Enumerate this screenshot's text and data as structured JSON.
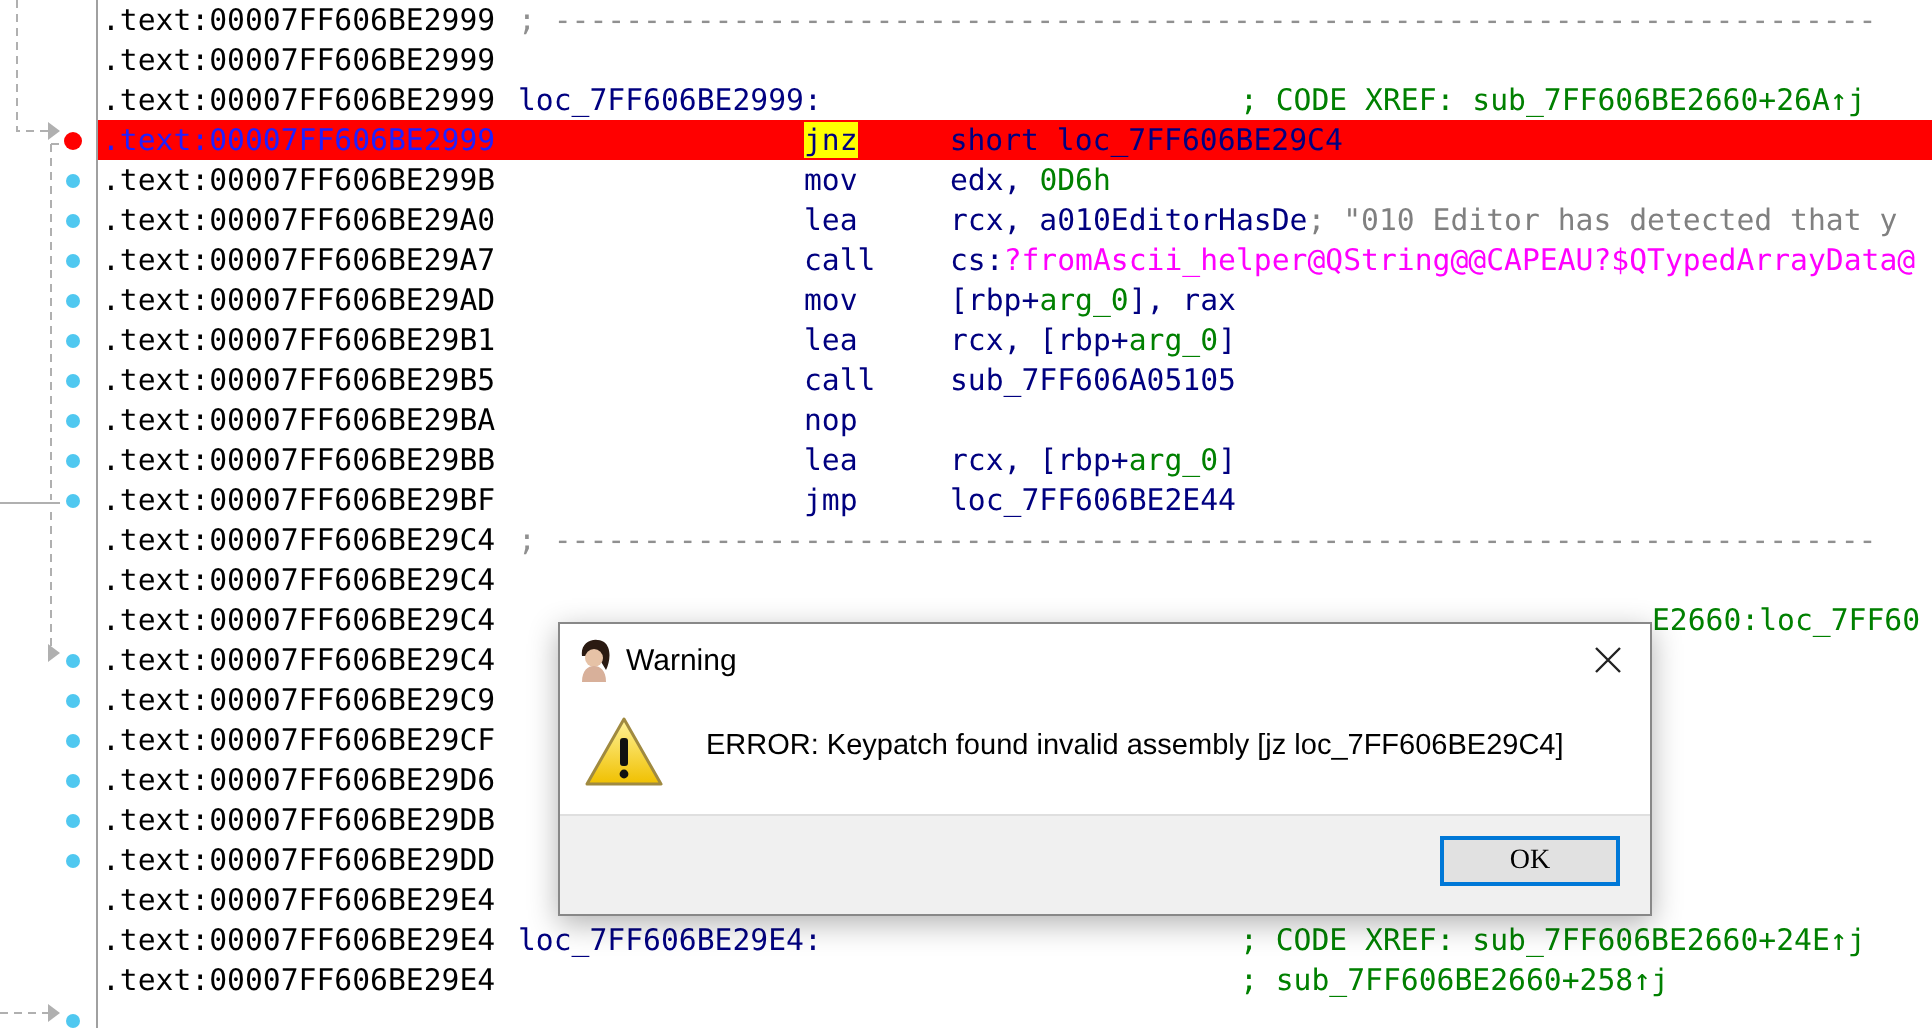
{
  "listing": {
    "rows": [
      {
        "address": ".text:00007FF606BE2999",
        "kind": "separator",
        "text": "; --------------------------------------------------------------------------",
        "selected": false,
        "breakpoint": false,
        "traced": false
      },
      {
        "address": ".text:00007FF606BE2999",
        "kind": "blank",
        "selected": false,
        "breakpoint": false,
        "traced": false
      },
      {
        "address": ".text:00007FF606BE2999",
        "kind": "label",
        "label": "loc_7FF606BE2999:",
        "comment": {
          "text": "; CODE XREF: sub_7FF606BE2660+26A↑j",
          "kind": "xref"
        },
        "selected": false,
        "breakpoint": false,
        "traced": false
      },
      {
        "address": ".text:00007FF606BE2999",
        "kind": "code",
        "mnemonic": "jnz",
        "operands": [
          {
            "text": "short loc_7FF606BE29C4",
            "kind": "plain"
          }
        ],
        "selected": true,
        "breakpoint": true,
        "traced": false
      },
      {
        "address": ".text:00007FF606BE299B",
        "kind": "code",
        "mnemonic": "mov",
        "operands": [
          {
            "text": "edx, ",
            "kind": "plain"
          },
          {
            "text": "0D6h",
            "kind": "number"
          }
        ],
        "selected": false,
        "breakpoint": false,
        "traced": true
      },
      {
        "address": ".text:00007FF606BE29A0",
        "kind": "code",
        "mnemonic": "lea",
        "operands": [
          {
            "text": "rcx, a010EditorHasDe",
            "kind": "plain"
          }
        ],
        "comment": {
          "text": "; \"010 Editor has detected that y",
          "kind": "string"
        },
        "selected": false,
        "breakpoint": false,
        "traced": true
      },
      {
        "address": ".text:00007FF606BE29A7",
        "kind": "code",
        "mnemonic": "call",
        "operands": [
          {
            "text": "cs:",
            "kind": "plain"
          },
          {
            "text": "?fromAscii_helper@QString@@CAPEAU?$QTypedArrayData@",
            "kind": "import"
          }
        ],
        "selected": false,
        "breakpoint": false,
        "traced": true
      },
      {
        "address": ".text:00007FF606BE29AD",
        "kind": "code",
        "mnemonic": "mov",
        "operands": [
          {
            "text": "[rbp+",
            "kind": "plain"
          },
          {
            "text": "arg_0",
            "kind": "number"
          },
          {
            "text": "], rax",
            "kind": "plain"
          }
        ],
        "selected": false,
        "breakpoint": false,
        "traced": true
      },
      {
        "address": ".text:00007FF606BE29B1",
        "kind": "code",
        "mnemonic": "lea",
        "operands": [
          {
            "text": "rcx, [rbp+",
            "kind": "plain"
          },
          {
            "text": "arg_0",
            "kind": "number"
          },
          {
            "text": "]",
            "kind": "plain"
          }
        ],
        "selected": false,
        "breakpoint": false,
        "traced": true
      },
      {
        "address": ".text:00007FF606BE29B5",
        "kind": "code",
        "mnemonic": "call",
        "operands": [
          {
            "text": "sub_7FF606A05105",
            "kind": "plain"
          }
        ],
        "selected": false,
        "breakpoint": false,
        "traced": true
      },
      {
        "address": ".text:00007FF606BE29BA",
        "kind": "code",
        "mnemonic": "nop",
        "selected": false,
        "breakpoint": false,
        "traced": true
      },
      {
        "address": ".text:00007FF606BE29BB",
        "kind": "code",
        "mnemonic": "lea",
        "operands": [
          {
            "text": "rcx, [rbp+",
            "kind": "plain"
          },
          {
            "text": "arg_0",
            "kind": "number"
          },
          {
            "text": "]",
            "kind": "plain"
          }
        ],
        "selected": false,
        "breakpoint": false,
        "traced": true
      },
      {
        "address": ".text:00007FF606BE29BF",
        "kind": "code",
        "mnemonic": "jmp",
        "operands": [
          {
            "text": "loc_7FF606BE2E44",
            "kind": "plain"
          }
        ],
        "selected": false,
        "breakpoint": false,
        "traced": true
      },
      {
        "address": ".text:00007FF606BE29C4",
        "kind": "separator",
        "text": "; --------------------------------------------------------------------------",
        "selected": false,
        "breakpoint": false,
        "traced": false
      },
      {
        "address": ".text:00007FF606BE29C4",
        "kind": "blank",
        "selected": false,
        "breakpoint": false,
        "traced": false
      },
      {
        "address": ".text:00007FF606BE29C4",
        "kind": "label",
        "comment": {
          "text": "E2660:loc_7FF60",
          "kind": "xref-tail"
        },
        "selected": false,
        "breakpoint": false,
        "traced": false
      },
      {
        "address": ".text:00007FF606BE29C4",
        "kind": "blank",
        "selected": false,
        "breakpoint": false,
        "traced": true
      },
      {
        "address": ".text:00007FF606BE29C9",
        "kind": "blank",
        "selected": false,
        "breakpoint": false,
        "traced": true
      },
      {
        "address": ".text:00007FF606BE29CF",
        "kind": "blank",
        "selected": false,
        "breakpoint": false,
        "traced": true
      },
      {
        "address": ".text:00007FF606BE29D6",
        "kind": "blank",
        "selected": false,
        "breakpoint": false,
        "traced": true
      },
      {
        "address": ".text:00007FF606BE29DB",
        "kind": "blank",
        "selected": false,
        "breakpoint": false,
        "traced": true
      },
      {
        "address": ".text:00007FF606BE29DD",
        "kind": "blank",
        "selected": false,
        "breakpoint": false,
        "traced": true
      },
      {
        "address": ".text:00007FF606BE29E4",
        "kind": "blank",
        "selected": false,
        "breakpoint": false,
        "traced": false
      },
      {
        "address": ".text:00007FF606BE29E4",
        "kind": "label",
        "label": "loc_7FF606BE29E4:",
        "comment": {
          "text": "; CODE XREF: sub_7FF606BE2660+24E↑j",
          "kind": "xref"
        },
        "selected": false,
        "breakpoint": false,
        "traced": false
      },
      {
        "address": ".text:00007FF606BE29E4",
        "kind": "label",
        "comment": {
          "text": "; sub_7FF606BE2660+258↑j",
          "kind": "xref"
        },
        "selected": false,
        "breakpoint": false,
        "traced": false
      },
      {
        "kind": "blank",
        "selected": false,
        "breakpoint": false,
        "traced": true
      }
    ]
  },
  "dialog": {
    "title": "Warning",
    "message": "ERROR: Keypatch found invalid assembly [jz loc_7FF606BE29C4]",
    "buttons": [
      {
        "label": "OK",
        "selected": true
      }
    ]
  }
}
